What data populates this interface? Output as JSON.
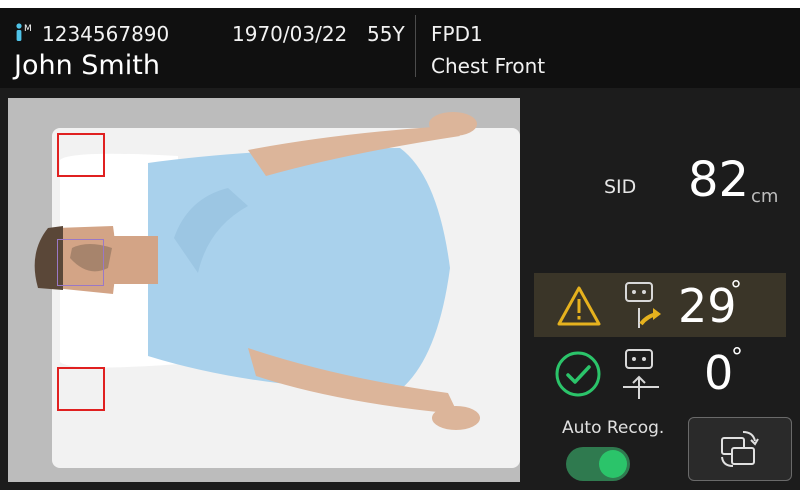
{
  "patient": {
    "id": "1234567890",
    "name": "John Smith",
    "birth_date": "1970/03/22",
    "age": "55Y",
    "sex_icon": "male-patient-icon"
  },
  "exam": {
    "detector": "FPD1",
    "protocol": "Chest Front"
  },
  "sid": {
    "label": "SID",
    "value": "82",
    "unit": "cm"
  },
  "alignment": [
    {
      "status": "warning",
      "icon": "warning-triangle-icon",
      "tilt_icon": "detector-tilt-icon",
      "value": "29",
      "unit": "°"
    },
    {
      "status": "ok",
      "icon": "check-circle-icon",
      "tilt_icon": "detector-level-icon",
      "value": "0",
      "unit": "°"
    }
  ],
  "auto_recog": {
    "label": "Auto Recog.",
    "enabled": true
  },
  "colors": {
    "warning": "#e6b21e",
    "ok": "#2bc46a",
    "roi": "#e02020",
    "face_box": "#9a78c6"
  }
}
